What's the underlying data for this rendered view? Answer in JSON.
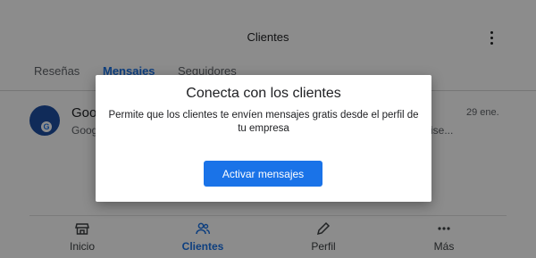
{
  "header": {
    "title": "Clientes",
    "menu_icon": "more-vert-icon"
  },
  "tabs": [
    {
      "label": "Reseñas",
      "active": false
    },
    {
      "label": "Mensajes",
      "active": true
    },
    {
      "label": "Seguidores",
      "active": false
    }
  ],
  "conversations": [
    {
      "name": "Goog",
      "preview": "Goog",
      "preview_suffix": "ise...",
      "time": "29 ene."
    }
  ],
  "bottom_nav": [
    {
      "label": "Inicio",
      "icon": "storefront-icon",
      "active": false
    },
    {
      "label": "Clientes",
      "icon": "people-icon",
      "active": true
    },
    {
      "label": "Perfil",
      "icon": "pencil-icon",
      "active": false
    },
    {
      "label": "Más",
      "icon": "more-horiz-icon",
      "active": false
    }
  ],
  "dialog": {
    "title": "Conecta con los clientes",
    "body": "Permite que los clientes te envíen mensajes gratis desde el perfil de tu empresa",
    "button_label": "Activar mensajes"
  },
  "colors": {
    "accent": "#1a73e8",
    "scrim": "rgba(0,0,0,0.45)"
  }
}
